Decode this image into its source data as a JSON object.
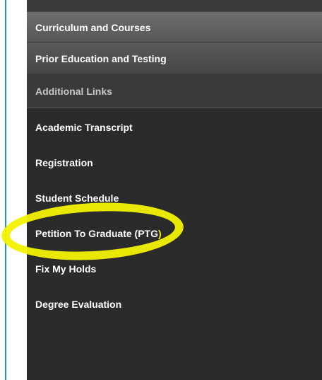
{
  "sections": [
    {
      "label": "Curriculum and Courses"
    },
    {
      "label": "Prior Education and Testing"
    },
    {
      "label": "Additional Links"
    }
  ],
  "links": [
    {
      "label": "Academic Transcript"
    },
    {
      "label": "Registration"
    },
    {
      "label": "Student Schedule"
    },
    {
      "label_main": "Petition To Graduate (PTG",
      "label_close": ")"
    },
    {
      "label": "Fix My Holds"
    },
    {
      "label": "Degree Evaluation"
    }
  ],
  "colors": {
    "panel_bg": "#2b2b2b",
    "header_bg": "#5e5e5e",
    "highlight": "#f2f200",
    "frame_border": "#1d8fe0"
  }
}
